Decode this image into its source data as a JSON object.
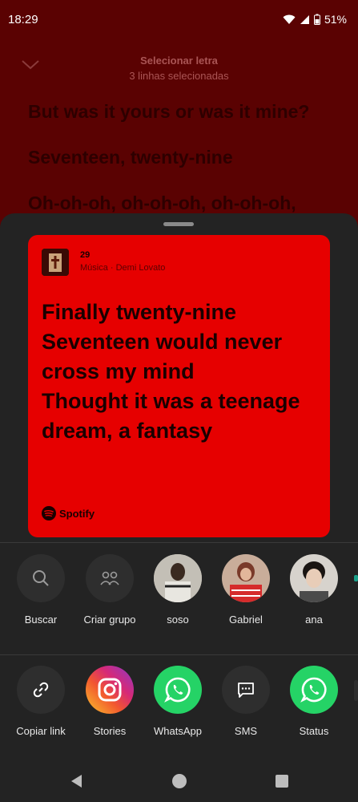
{
  "status": {
    "time": "18:29",
    "battery": "51%"
  },
  "lyrics_screen": {
    "title": "Selecionar letra",
    "subtitle": "3 linhas selecionadas",
    "lines": [
      "But was it yours or was it mine?",
      "Seventeen, twenty-nine",
      "Oh-oh-oh, oh-oh-oh, oh-oh-oh,"
    ]
  },
  "card": {
    "song": "29",
    "meta": "Música · Demi Lovato",
    "lyrics": [
      "Finally twenty-nine",
      "Seventeen would never",
      "cross my mind",
      "Thought it was a teenage",
      "dream, a fantasy"
    ],
    "brand": "Spotify",
    "background": "#e60000"
  },
  "contacts": [
    {
      "label": "Buscar",
      "icon": "search-icon"
    },
    {
      "label": "Criar grupo",
      "icon": "group-icon"
    },
    {
      "label": "soso",
      "icon": "avatar"
    },
    {
      "label": "Gabriel",
      "icon": "avatar"
    },
    {
      "label": "ana",
      "icon": "avatar"
    }
  ],
  "share_apps": [
    {
      "label": "Copiar link",
      "icon": "link-icon"
    },
    {
      "label": "Stories",
      "icon": "instagram-icon"
    },
    {
      "label": "WhatsApp",
      "icon": "whatsapp-icon"
    },
    {
      "label": "SMS",
      "icon": "sms-icon"
    },
    {
      "label": "Status",
      "icon": "whatsapp-icon"
    }
  ]
}
